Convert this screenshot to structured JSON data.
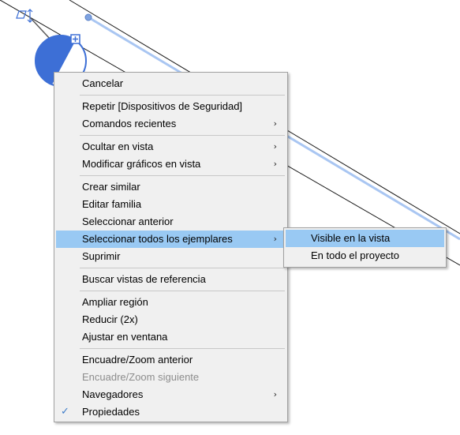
{
  "colors": {
    "highlight": "#99c9f3",
    "menu_background": "#f0f0f0",
    "disabled_text": "#8d8d8d",
    "element_fill": "#3d6fd6",
    "selection_line": "#a9c6f2"
  },
  "menu": {
    "items": {
      "cancel": {
        "label": "Cancelar"
      },
      "repeat": {
        "label": "Repetir [Dispositivos de Seguridad]"
      },
      "recent_commands": {
        "label": "Comandos recientes",
        "arrow": "›"
      },
      "hide_in_view": {
        "label": "Ocultar en vista",
        "arrow": "›"
      },
      "override_graphics": {
        "label": "Modificar gráficos en vista",
        "arrow": "›"
      },
      "create_similar": {
        "label": "Crear similar"
      },
      "edit_family": {
        "label": "Editar familia"
      },
      "select_previous": {
        "label": "Seleccionar anterior"
      },
      "select_all_instances": {
        "label": "Seleccionar todos los ejemplares",
        "arrow": "›"
      },
      "delete": {
        "label": "Suprimir"
      },
      "find_referring_views": {
        "label": "Buscar vistas de referencia"
      },
      "zoom_in_region": {
        "label": "Ampliar región"
      },
      "zoom_out": {
        "label": "Reducir (2x)"
      },
      "zoom_to_fit": {
        "label": "Ajustar en ventana"
      },
      "previous_pan_zoom": {
        "label": "Encuadre/Zoom anterior"
      },
      "next_pan_zoom": {
        "label": "Encuadre/Zoom siguiente"
      },
      "browsers": {
        "label": "Navegadores",
        "arrow": "›"
      },
      "properties": {
        "label": "Propiedades",
        "check": "✓"
      }
    }
  },
  "submenu": {
    "items": {
      "visible_in_view": {
        "label": "Visible en la vista"
      },
      "entire_project": {
        "label": "En todo el proyecto"
      }
    }
  }
}
